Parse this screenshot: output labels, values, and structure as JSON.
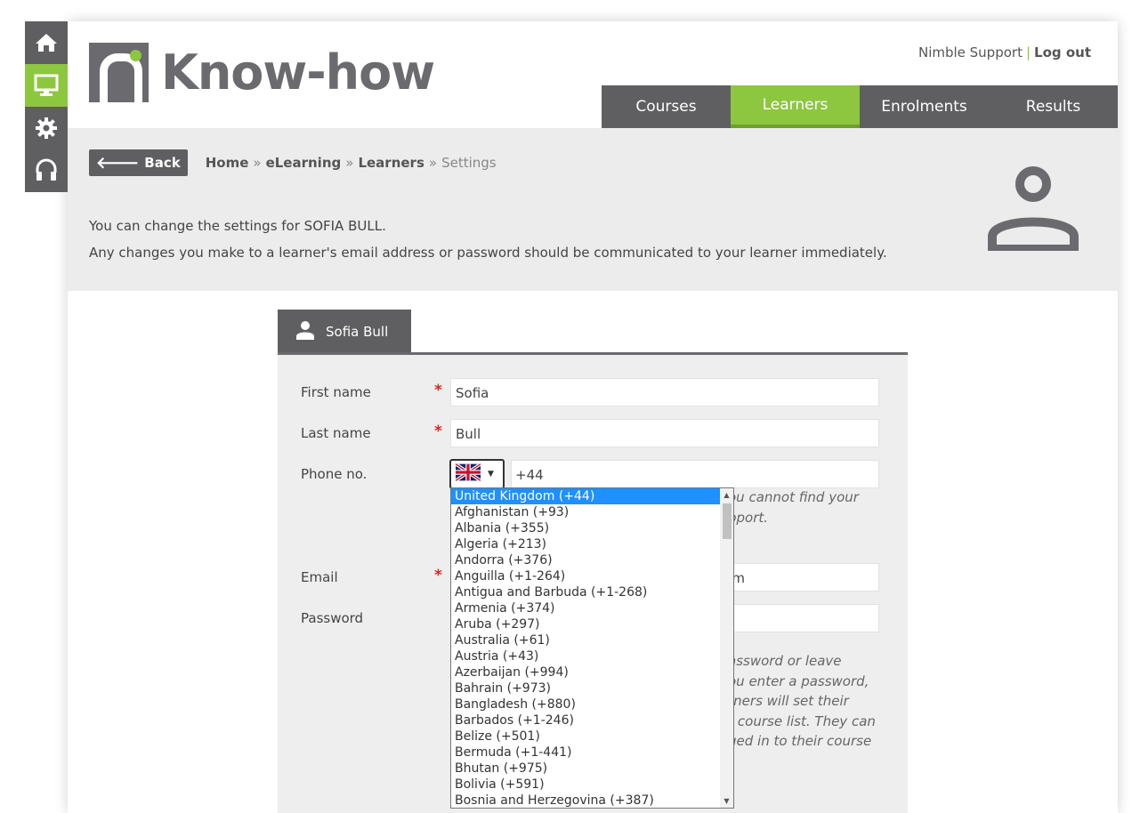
{
  "header": {
    "logo_text": "Know-how",
    "support_link": "Nimble Support",
    "separator": "|",
    "logout_link": "Log out"
  },
  "rail": [
    "home-icon",
    "monitor-icon",
    "gear-icon",
    "headset-icon"
  ],
  "nav": {
    "tabs": [
      "Courses",
      "Learners",
      "Enrolments",
      "Results"
    ],
    "active": "Learners"
  },
  "breadcrumb": {
    "back_label": "Back",
    "items": [
      "Home",
      "eLearning",
      "Learners"
    ],
    "separator": "»",
    "current": "Settings"
  },
  "info": {
    "line1": "You can change the settings for SOFIA BULL.",
    "line2": "Any changes you make to a learner's email address or password should be communicated to your learner immediately."
  },
  "form": {
    "tab_label": "Sofia Bull",
    "first_name_label": "First name",
    "first_name_value": "Sofia",
    "last_name_label": "Last name",
    "last_name_value": "Bull",
    "phone_label": "Phone no.",
    "phone_value": "+44",
    "phone_hint_line1": "ou cannot find your",
    "phone_hint_line2": "pport.",
    "email_label": "Email",
    "email_value_partial": "m",
    "password_label": "Password",
    "password_hint": [
      "assword or leave",
      "ou enter a password,",
      "rners will set their",
      "r course list. They can",
      "ged in to their course"
    ],
    "required_mark": "*"
  },
  "country_dropdown": {
    "selected": "United Kingdom (+44)",
    "options": [
      "United Kingdom (+44)",
      "Afghanistan (+93)",
      "Albania (+355)",
      "Algeria (+213)",
      "Andorra (+376)",
      "Anguilla (+1-264)",
      "Antigua and Barbuda (+1-268)",
      "Armenia (+374)",
      "Aruba (+297)",
      "Australia (+61)",
      "Austria (+43)",
      "Azerbaijan (+994)",
      "Bahrain (+973)",
      "Bangladesh (+880)",
      "Barbados (+1-246)",
      "Belize (+501)",
      "Bermuda (+1-441)",
      "Bhutan (+975)",
      "Bolivia (+591)",
      "Bosnia and Herzegovina (+387)"
    ]
  },
  "colors": {
    "accent": "#8dc63f",
    "dark": "#5f5f61",
    "required": "#d9261c",
    "selection": "#1e90ff"
  }
}
